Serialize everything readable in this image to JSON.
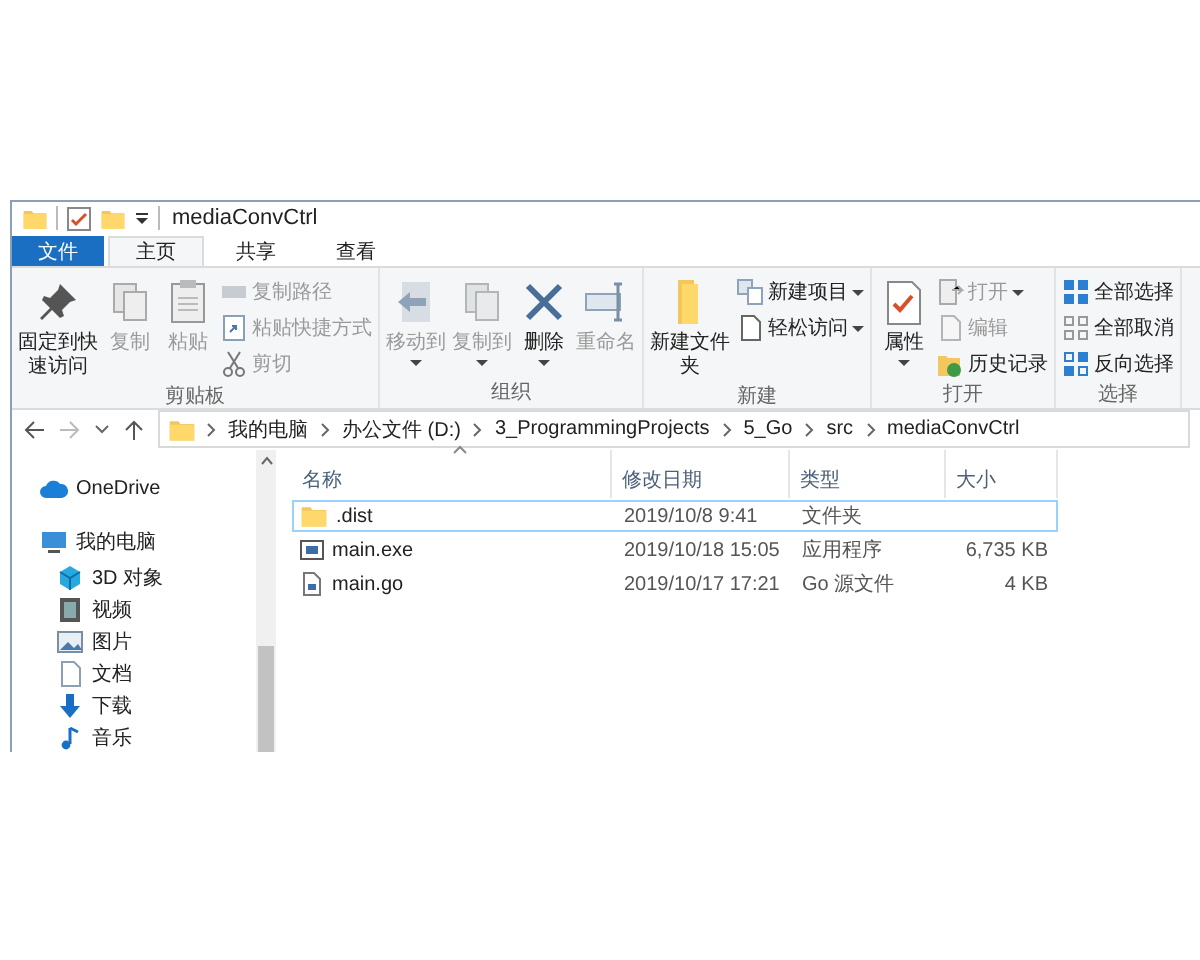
{
  "window": {
    "title": "mediaConvCtrl"
  },
  "tabs": [
    {
      "label": "文件",
      "kind": "file",
      "selected": false
    },
    {
      "label": "主页",
      "kind": "tab",
      "selected": true
    },
    {
      "label": "共享",
      "kind": "tab",
      "selected": false
    },
    {
      "label": "查看",
      "kind": "tab",
      "selected": false
    }
  ],
  "ribbon": {
    "groups": [
      {
        "label": "剪贴板",
        "items": [
          {
            "kind": "large",
            "label": "固定到快速访问",
            "disabled": false,
            "dropdown": false
          },
          {
            "kind": "large",
            "label": "复制",
            "disabled": true,
            "dropdown": false
          },
          {
            "kind": "large",
            "label": "粘贴",
            "disabled": true,
            "dropdown": false
          },
          {
            "kind": "small",
            "label": "复制路径",
            "disabled": true,
            "dropdown": false
          },
          {
            "kind": "small",
            "label": "粘贴快捷方式",
            "disabled": true,
            "dropdown": false
          },
          {
            "kind": "small",
            "label": "剪切",
            "disabled": true,
            "dropdown": false
          }
        ]
      },
      {
        "label": "组织",
        "items": [
          {
            "kind": "large",
            "label": "移动到",
            "disabled": true,
            "dropdown": true
          },
          {
            "kind": "large",
            "label": "复制到",
            "disabled": true,
            "dropdown": true
          },
          {
            "kind": "large",
            "label": "删除",
            "disabled": false,
            "dropdown": true
          },
          {
            "kind": "large",
            "label": "重命名",
            "disabled": true,
            "dropdown": false
          }
        ]
      },
      {
        "label": "新建",
        "items": [
          {
            "kind": "large",
            "label": "新建文件夹",
            "disabled": false,
            "dropdown": false
          },
          {
            "kind": "small",
            "label": "新建项目",
            "disabled": false,
            "dropdown": true
          },
          {
            "kind": "small",
            "label": "轻松访问",
            "disabled": false,
            "dropdown": true
          }
        ]
      },
      {
        "label": "打开",
        "items": [
          {
            "kind": "large",
            "label": "属性",
            "disabled": false,
            "dropdown": true
          },
          {
            "kind": "small",
            "label": "打开",
            "disabled": true,
            "dropdown": true
          },
          {
            "kind": "small",
            "label": "编辑",
            "disabled": true,
            "dropdown": false
          },
          {
            "kind": "small",
            "label": "历史记录",
            "disabled": false,
            "dropdown": false
          }
        ]
      },
      {
        "label": "选择",
        "items": [
          {
            "kind": "small",
            "label": "全部选择",
            "disabled": false,
            "dropdown": false
          },
          {
            "kind": "small",
            "label": "全部取消",
            "disabled": false,
            "dropdown": false
          },
          {
            "kind": "small",
            "label": "反向选择",
            "disabled": false,
            "dropdown": false
          }
        ]
      }
    ]
  },
  "address": {
    "back_disabled": false,
    "forward_disabled": true,
    "path": [
      "我的电脑",
      "办公文件 (D:)",
      "3_ProgrammingProjects",
      "5_Go",
      "src",
      "mediaConvCtrl"
    ]
  },
  "sidebar": {
    "items": [
      {
        "label": "OneDrive",
        "selected": false
      },
      {
        "label": "我的电脑",
        "selected": false,
        "children": [
          {
            "label": "3D 对象",
            "selected": false
          },
          {
            "label": "视频",
            "selected": false
          },
          {
            "label": "图片",
            "selected": false
          },
          {
            "label": "文档",
            "selected": false
          },
          {
            "label": "下载",
            "selected": false
          },
          {
            "label": "音乐",
            "selected": false
          }
        ]
      }
    ]
  },
  "table": {
    "columns": [
      "名称",
      "修改日期",
      "类型",
      "大小"
    ],
    "rows": [
      {
        "kind": "folder",
        "name": ".dist",
        "date": "2019/10/8 9:41",
        "type": "文件夹",
        "size": "",
        "selected": true
      },
      {
        "kind": "exe",
        "name": "main.exe",
        "date": "2019/10/18 15:05",
        "type": "应用程序",
        "size": "6,735 KB",
        "selected": false
      },
      {
        "kind": "file",
        "name": "main.go",
        "date": "2019/10/17 17:21",
        "type": "Go 源文件",
        "size": "4 KB",
        "selected": false
      }
    ]
  }
}
